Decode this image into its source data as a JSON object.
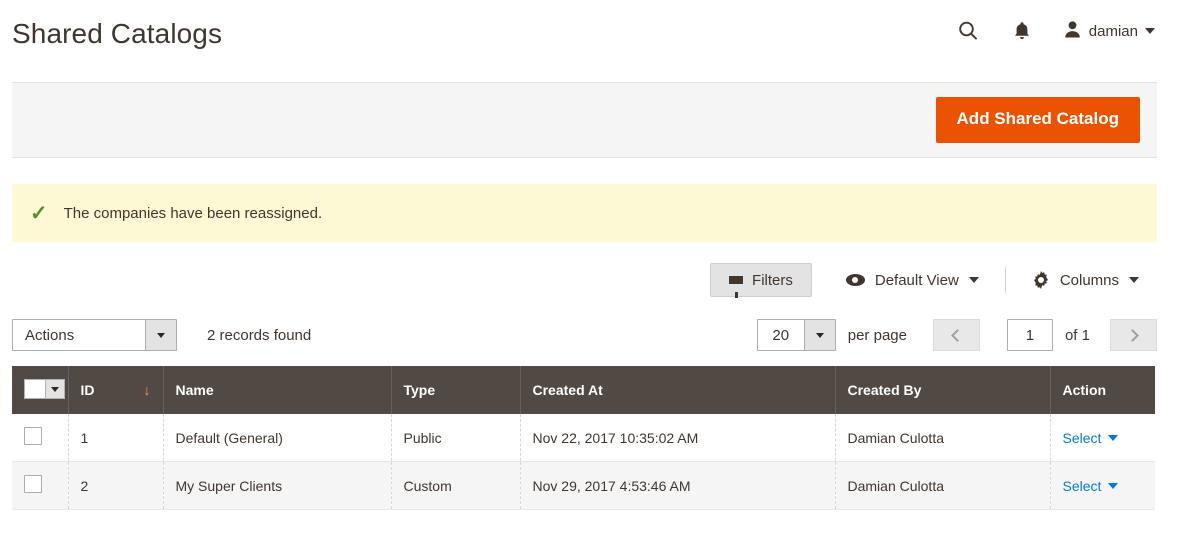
{
  "header": {
    "title": "Shared Catalogs",
    "search_icon": "search-icon",
    "notifications_icon": "bell-icon",
    "avatar_icon": "user-avatar-icon",
    "user_name": "damian"
  },
  "page_actions": {
    "add_button_label": "Add Shared Catalog",
    "accent_color": "#eb5202"
  },
  "message": {
    "icon": "check-icon",
    "text": "The companies have been reassigned.",
    "background_color": "#fdf9d4",
    "icon_color": "#5a8e2d"
  },
  "toolbar": {
    "filters_label": "Filters",
    "filters_icon": "funnel-icon",
    "view_label": "Default View",
    "view_icon": "eye-icon",
    "columns_label": "Columns",
    "columns_icon": "gear-icon"
  },
  "grid_header": {
    "actions_label": "Actions",
    "records_found": "2 records found",
    "per_page_value": "20",
    "per_page_label": "per page",
    "prev_icon": "chevron-left-icon",
    "next_icon": "chevron-right-icon",
    "current_page": "1",
    "of_total": "of 1"
  },
  "grid": {
    "columns": [
      {
        "key": "checkbox",
        "label": ""
      },
      {
        "key": "id",
        "label": "ID"
      },
      {
        "key": "name",
        "label": "Name"
      },
      {
        "key": "type",
        "label": "Type"
      },
      {
        "key": "created_at",
        "label": "Created At"
      },
      {
        "key": "created_by",
        "label": "Created By"
      },
      {
        "key": "action",
        "label": "Action"
      }
    ],
    "sort": {
      "column": "ID",
      "direction_glyph": "↓",
      "color": "#ff9437"
    },
    "action_link_label": "Select",
    "rows": [
      {
        "id": "1",
        "name": "Default (General)",
        "type": "Public",
        "created_at": "Nov 22, 2017 10:35:02 AM",
        "created_by": "Damian Culotta",
        "action": "Select"
      },
      {
        "id": "2",
        "name": "My Super Clients",
        "type": "Custom",
        "created_at": "Nov 29, 2017 4:53:46 AM",
        "created_by": "Damian Culotta",
        "action": "Select"
      }
    ]
  }
}
